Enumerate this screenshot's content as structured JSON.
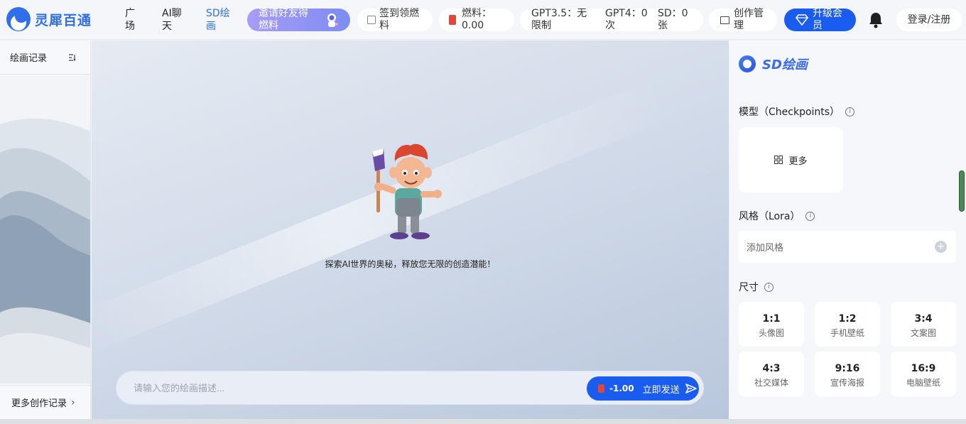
{
  "app": {
    "name": "灵犀百通"
  },
  "nav": [
    {
      "label": "广场"
    },
    {
      "label": "AI聊天"
    },
    {
      "label": "SD绘画"
    }
  ],
  "header": {
    "invite_label": "邀请好友得燃料",
    "signin_label": "签到领燃料",
    "fuel_label": "燃料：0.00",
    "quota_gpt35": "GPT3.5：无限制",
    "quota_gpt4": "GPT4：0次",
    "quota_sd": "SD：0张",
    "manage_label": "创作管理",
    "upgrade_label": "升级会员",
    "login_label": "登录/注册"
  },
  "sidebar": {
    "title": "绘画记录",
    "footer": "更多创作记录"
  },
  "main": {
    "tagline": "探索AI世界的奥秘，释放您无限的创造潜能！",
    "prompt_placeholder": "请输入您的绘画描述...",
    "send_cost": "-1.00",
    "send_label": "立即发送"
  },
  "panel": {
    "title": "SD绘画",
    "model_label": "模型（Checkpoints）",
    "model_more": "更多",
    "style_label": "风格（Lora）",
    "style_placeholder": "添加风格",
    "size_label": "尺寸",
    "ratios": [
      {
        "ratio": "1:1",
        "desc": "头像图"
      },
      {
        "ratio": "1:2",
        "desc": "手机壁纸"
      },
      {
        "ratio": "3:4",
        "desc": "文案图"
      },
      {
        "ratio": "4:3",
        "desc": "社交媒体"
      },
      {
        "ratio": "9:16",
        "desc": "宣传海报"
      },
      {
        "ratio": "16:9",
        "desc": "电脑壁纸"
      }
    ]
  },
  "colors": {
    "accent": "#1a5cf0",
    "brand": "#2f6fe9",
    "fuel": "#e0473c"
  },
  "icons": [
    "logo-icon",
    "astronaut-icon",
    "calendar-icon",
    "fuel-can-icon",
    "folder-icon",
    "diamond-icon",
    "bell-icon",
    "filter-icon",
    "chevron-right-icon",
    "send-arrow-icon",
    "info-icon",
    "grid-icon",
    "plus-icon"
  ]
}
